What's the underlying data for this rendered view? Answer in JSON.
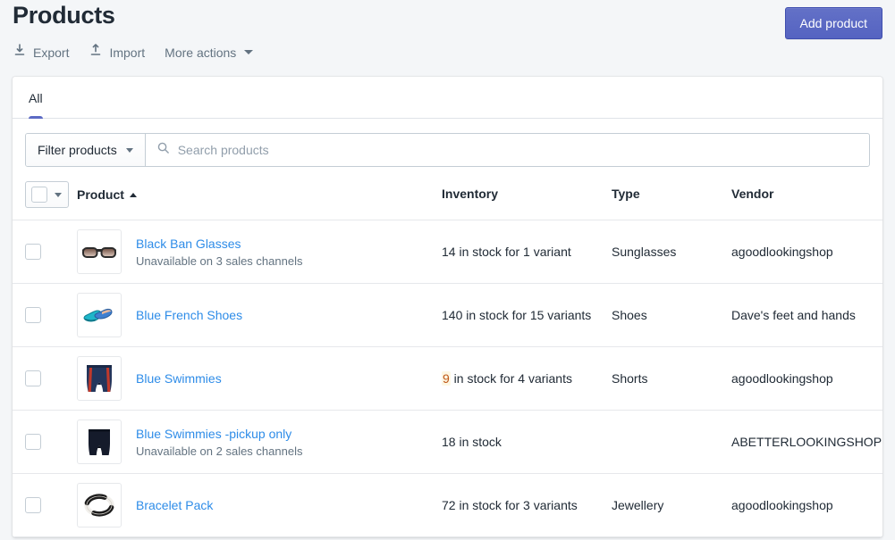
{
  "header": {
    "title": "Products",
    "actions": [
      {
        "label": "Export",
        "icon": "export-icon"
      },
      {
        "label": "Import",
        "icon": "import-icon"
      },
      {
        "label": "More actions",
        "icon": "chevron-down-icon"
      }
    ],
    "primary_action": {
      "label": "Add product",
      "color": "#5c6ac4"
    }
  },
  "tabs": [
    {
      "label": "All",
      "active": true
    }
  ],
  "filters": {
    "filter_button_label": "Filter products",
    "search_placeholder": "Search products",
    "search_value": ""
  },
  "table": {
    "columns": {
      "product": "Product",
      "inventory": "Inventory",
      "type": "Type",
      "vendor": "Vendor"
    },
    "sort": {
      "column": "Product",
      "direction": "ascending",
      "indicator": "▲"
    },
    "rows": [
      {
        "name": "Black Ban Glasses",
        "subtitle": "Unavailable on 3 sales channels",
        "inventory_count": "14",
        "inventory_suffix": " in stock for 1 variant",
        "inventory_low": false,
        "type": "Sunglasses",
        "vendor": "agoodlookingshop",
        "thumbnail": "sunglasses-thumbnail",
        "selected": false
      },
      {
        "name": "Blue French Shoes",
        "subtitle": "",
        "inventory_count": "140",
        "inventory_suffix": " in stock for 15 variants",
        "inventory_low": false,
        "type": "Shoes",
        "vendor": "Dave's feet and hands",
        "thumbnail": "shoes-thumbnail",
        "selected": false
      },
      {
        "name": "Blue Swimmies",
        "subtitle": "",
        "inventory_count": "9",
        "inventory_suffix": " in stock for 4 variants",
        "inventory_low": true,
        "type": "Shorts",
        "vendor": "agoodlookingshop",
        "thumbnail": "swim-shorts-thumbnail",
        "selected": false
      },
      {
        "name": "Blue Swimmies -pickup only",
        "subtitle": "Unavailable on 2 sales channels",
        "inventory_count": "18",
        "inventory_suffix": " in stock",
        "inventory_low": false,
        "type": "",
        "vendor": "ABETTERLOOKINGSHOP",
        "thumbnail": "navy-shorts-thumbnail",
        "selected": false
      },
      {
        "name": "Bracelet Pack",
        "subtitle": "",
        "inventory_count": "72",
        "inventory_suffix": " in stock for 3 variants",
        "inventory_low": false,
        "type": "Jewellery",
        "vendor": "agoodlookingshop",
        "thumbnail": "bracelet-thumbnail",
        "selected": false
      }
    ]
  }
}
